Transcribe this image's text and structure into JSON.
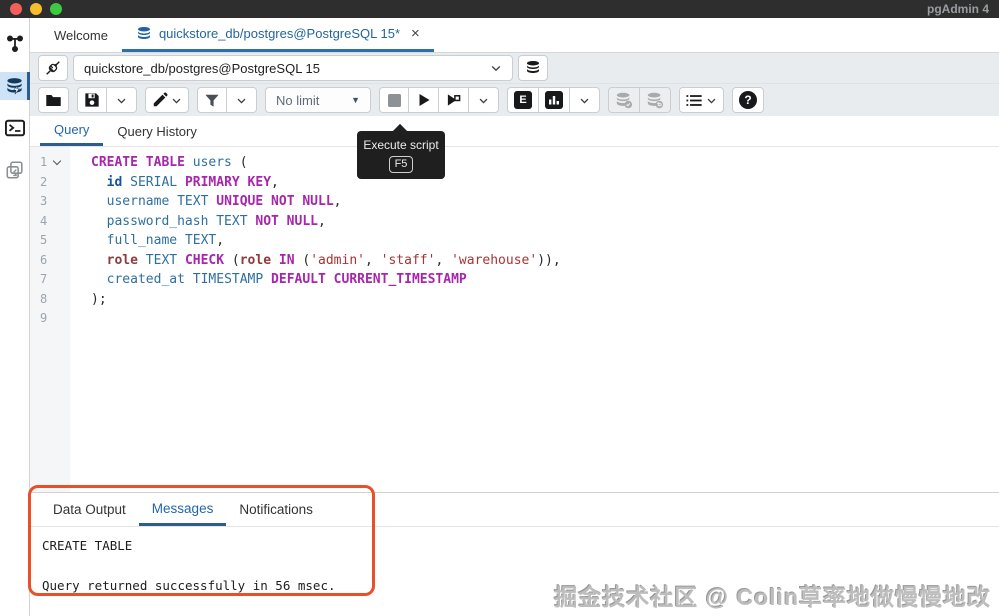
{
  "titlebar": {
    "app_title": "pgAdmin 4"
  },
  "sidebar": {
    "icons": [
      "object-explorer",
      "query-tool",
      "psql-tool",
      "schema-diff"
    ]
  },
  "doc_tabs": {
    "welcome_label": "Welcome",
    "active": {
      "title": "quickstore_db/postgres@PostgreSQL 15*",
      "close_glyph": "×"
    }
  },
  "connection": {
    "value": "quickstore_db/postgres@PostgreSQL 15"
  },
  "toolbar": {
    "limit_label": "No limit",
    "caret_glyph": "▼",
    "explain_label": "E",
    "help_label": "?"
  },
  "query_tabs": [
    {
      "label": "Query",
      "active": true
    },
    {
      "label": "Query History",
      "active": false
    }
  ],
  "tooltip": {
    "label": "Execute script",
    "key": "F5"
  },
  "editor": {
    "lines": [
      {
        "no": "1",
        "fold": true,
        "tokens": [
          {
            "c": "kw",
            "s": "CREATE TABLE"
          },
          {
            "c": "pln",
            "s": " "
          },
          {
            "c": "var",
            "s": "users"
          },
          {
            "c": "pln",
            "s": " ("
          }
        ]
      },
      {
        "no": "2",
        "tokens": [
          {
            "c": "pln",
            "s": "  "
          },
          {
            "c": "def",
            "s": "id"
          },
          {
            "c": "pln",
            "s": " "
          },
          {
            "c": "type",
            "s": "SERIAL"
          },
          {
            "c": "pln",
            "s": " "
          },
          {
            "c": "kw",
            "s": "PRIMARY KEY"
          },
          {
            "c": "pln",
            "s": ","
          }
        ]
      },
      {
        "no": "3",
        "tokens": [
          {
            "c": "pln",
            "s": "  "
          },
          {
            "c": "var",
            "s": "username"
          },
          {
            "c": "pln",
            "s": " "
          },
          {
            "c": "type",
            "s": "TEXT"
          },
          {
            "c": "pln",
            "s": " "
          },
          {
            "c": "kw",
            "s": "UNIQUE NOT NULL"
          },
          {
            "c": "pln",
            "s": ","
          }
        ]
      },
      {
        "no": "4",
        "tokens": [
          {
            "c": "pln",
            "s": "  "
          },
          {
            "c": "var",
            "s": "password_hash"
          },
          {
            "c": "pln",
            "s": " "
          },
          {
            "c": "type",
            "s": "TEXT"
          },
          {
            "c": "pln",
            "s": " "
          },
          {
            "c": "kw",
            "s": "NOT NULL"
          },
          {
            "c": "pln",
            "s": ","
          }
        ]
      },
      {
        "no": "5",
        "tokens": [
          {
            "c": "pln",
            "s": "  "
          },
          {
            "c": "var",
            "s": "full_name"
          },
          {
            "c": "pln",
            "s": " "
          },
          {
            "c": "type",
            "s": "TEXT"
          },
          {
            "c": "pln",
            "s": ","
          }
        ]
      },
      {
        "no": "6",
        "tokens": [
          {
            "c": "pln",
            "s": "  "
          },
          {
            "c": "role",
            "s": "role"
          },
          {
            "c": "pln",
            "s": " "
          },
          {
            "c": "type",
            "s": "TEXT"
          },
          {
            "c": "pln",
            "s": " "
          },
          {
            "c": "kw",
            "s": "CHECK"
          },
          {
            "c": "pln",
            "s": " ("
          },
          {
            "c": "role",
            "s": "role"
          },
          {
            "c": "pln",
            "s": " "
          },
          {
            "c": "kw",
            "s": "IN"
          },
          {
            "c": "pln",
            "s": " ("
          },
          {
            "c": "str",
            "s": "'admin'"
          },
          {
            "c": "pln",
            "s": ", "
          },
          {
            "c": "str",
            "s": "'staff'"
          },
          {
            "c": "pln",
            "s": ", "
          },
          {
            "c": "str",
            "s": "'warehouse'"
          },
          {
            "c": "pln",
            "s": ")),"
          }
        ]
      },
      {
        "no": "7",
        "tokens": [
          {
            "c": "pln",
            "s": "  "
          },
          {
            "c": "var",
            "s": "created_at"
          },
          {
            "c": "pln",
            "s": " "
          },
          {
            "c": "type",
            "s": "TIMESTAMP"
          },
          {
            "c": "pln",
            "s": " "
          },
          {
            "c": "kw",
            "s": "DEFAULT"
          },
          {
            "c": "pln",
            "s": " "
          },
          {
            "c": "kw",
            "s": "CURRENT_TIMESTAMP"
          }
        ]
      },
      {
        "no": "8",
        "tokens": [
          {
            "c": "pln",
            "s": ");"
          }
        ]
      },
      {
        "no": "9",
        "tokens": []
      }
    ]
  },
  "output_panel": {
    "tabs": [
      {
        "label": "Data Output",
        "active": false
      },
      {
        "label": "Messages",
        "active": true
      },
      {
        "label": "Notifications",
        "active": false
      }
    ],
    "messages": [
      "CREATE TABLE",
      "",
      "Query returned successfully in 56 msec."
    ]
  },
  "watermark": "掘金技术社区 @ Colin草率地做慢慢地改",
  "colors": {
    "accent_blue": "#2c6fad",
    "active_text_blue": "#2166ac",
    "annotation_orange": "#e8502a",
    "titlebar_bg": "#2e2e2e",
    "toolbar_bg": "#e9ecef",
    "syntax": {
      "keyword": "#a826ad",
      "type": "#2f6f9f",
      "identifier": "#2f6f9f",
      "definition": "#15559a",
      "builtin": "#8e3b3b",
      "string": "#a63434"
    }
  }
}
